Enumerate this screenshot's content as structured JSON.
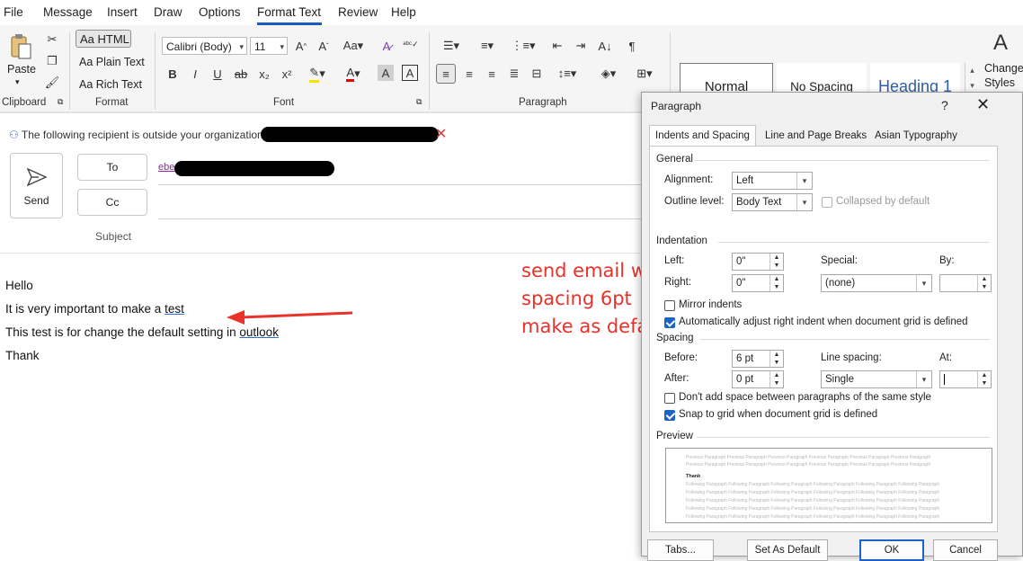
{
  "menu": [
    "File",
    "Message",
    "Insert",
    "Draw",
    "Options",
    "Format Text",
    "Review",
    "Help"
  ],
  "ribbon": {
    "clipboard": {
      "paste": "Paste",
      "label": "Clipboard"
    },
    "format": {
      "html": "Aa HTML",
      "plain": "Aa Plain Text",
      "rich": "Aa Rich Text",
      "label": "Format"
    },
    "font": {
      "name": "Calibri (Body)",
      "size": "11",
      "label": "Font"
    },
    "paragraph": {
      "label": "Paragraph"
    },
    "styles": {
      "normal": "Normal",
      "no_spacing": "No Spacing",
      "heading1": "Heading 1",
      "change": "Change",
      "change2": "Styles"
    }
  },
  "compose": {
    "info": "The following recipient is outside your organization:",
    "send": "Send",
    "to": "To",
    "cc": "Cc",
    "to_value": "ebe",
    "subject": "Subject",
    "body": {
      "line1": "Hello",
      "line2_pre": "It is very important to make a ",
      "line2_link": "test",
      "line3_pre": "This test is for change the default setting in ",
      "line3_link": "outlook",
      "line4": "Thank"
    },
    "annotation": [
      "send email with",
      "spacing 6pt",
      "make as default"
    ]
  },
  "dialog": {
    "title": "Paragraph",
    "help": "?",
    "close": "✕",
    "tabs": [
      "Indents and Spacing",
      "Line and Page Breaks",
      "Asian Typography"
    ],
    "general": {
      "title": "General",
      "alignment_label": "Alignment:",
      "alignment": "Left",
      "outline_label": "Outline level:",
      "outline": "Body Text",
      "collapsed": "Collapsed by default"
    },
    "indentation": {
      "title": "Indentation",
      "left_label": "Left:",
      "left": "0\"",
      "right_label": "Right:",
      "right": "0\"",
      "special_label": "Special:",
      "special": "(none)",
      "by_label": "By:",
      "mirror": "Mirror indents",
      "auto_adjust": "Automatically adjust right indent when document grid is defined"
    },
    "spacing": {
      "title": "Spacing",
      "before_label": "Before:",
      "before": "6 pt",
      "after_label": "After:",
      "after": "0 pt",
      "line_label": "Line spacing:",
      "line": "Single",
      "at_label": "At:",
      "no_space": "Don't add space between paragraphs of the same style",
      "snap": "Snap to grid when document grid is defined"
    },
    "preview": {
      "title": "Preview",
      "prev_text": "Previous Paragraph Previous Paragraph Previous Paragraph Previous Paragraph Previous Paragraph Previous Paragraph",
      "sample": "Thank",
      "follow_text": "Following Paragraph Following Paragraph Following Paragraph Following Paragraph Following Paragraph Following Paragraph"
    },
    "buttons": {
      "tabs": "Tabs...",
      "set_default": "Set As Default",
      "ok": "OK",
      "cancel": "Cancel"
    }
  },
  "colors": {
    "accent": "#185abd",
    "annotation": "#e8322a",
    "checked": "#1c63c7"
  }
}
